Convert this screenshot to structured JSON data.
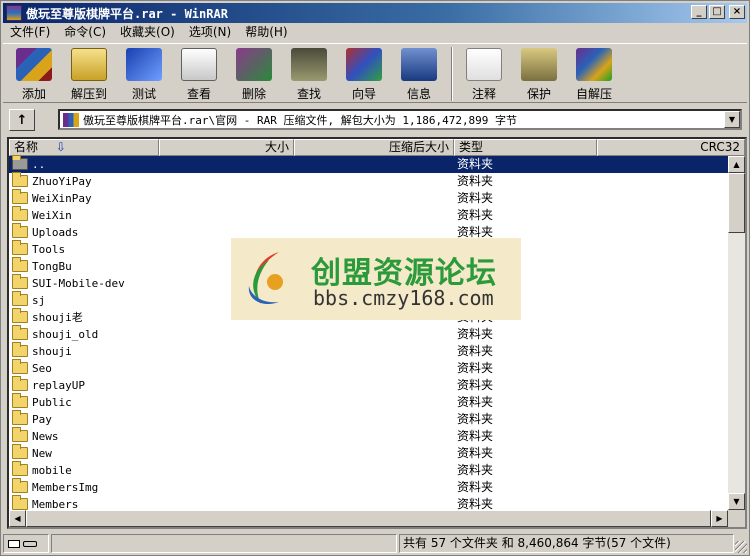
{
  "window": {
    "title": "傲玩至尊版棋牌平台.rar - WinRAR",
    "minimize": "_",
    "maximize": "□",
    "close": "×"
  },
  "menu": [
    {
      "label": "文件(F)"
    },
    {
      "label": "命令(C)"
    },
    {
      "label": "收藏夹(O)"
    },
    {
      "label": "选项(N)"
    },
    {
      "label": "帮助(H)"
    }
  ],
  "toolbar": [
    {
      "label": "添加",
      "icon": "add-icon"
    },
    {
      "label": "解压到",
      "icon": "extract-icon"
    },
    {
      "label": "测试",
      "icon": "test-icon"
    },
    {
      "label": "查看",
      "icon": "view-icon"
    },
    {
      "label": "删除",
      "icon": "delete-icon"
    },
    {
      "label": "查找",
      "icon": "find-icon"
    },
    {
      "label": "向导",
      "icon": "wizard-icon"
    },
    {
      "label": "信息",
      "icon": "info-icon"
    },
    {
      "label": "注释",
      "icon": "comment-icon"
    },
    {
      "label": "保护",
      "icon": "protect-icon"
    },
    {
      "label": "自解压",
      "icon": "sfx-icon"
    }
  ],
  "address": {
    "up_icon": "↑",
    "path": "傲玩至尊版棋牌平台.rar\\官网 - RAR 压缩文件, 解包大小为 1,186,472,899 字节",
    "dropdown": "▼"
  },
  "columns": {
    "name": "名称",
    "sort_arrow": "⇩",
    "size": "大小",
    "packed": "压缩后大小",
    "type": "类型",
    "crc": "CRC32"
  },
  "files": [
    {
      "name": "..",
      "type": "资料夹",
      "selected": true
    },
    {
      "name": "ZhuoYiPay",
      "type": "资料夹"
    },
    {
      "name": "WeiXinPay",
      "type": "资料夹"
    },
    {
      "name": "WeiXin",
      "type": "资料夹"
    },
    {
      "name": "Uploads",
      "type": "资料夹"
    },
    {
      "name": "Tools",
      "type": "资料夹"
    },
    {
      "name": "TongBu",
      "type": "资料夹"
    },
    {
      "name": "SUI-Mobile-dev",
      "type": "资料夹"
    },
    {
      "name": "sj",
      "type": "资料夹"
    },
    {
      "name": "shouji老",
      "type": "资料夹"
    },
    {
      "name": "shouji_old",
      "type": "资料夹"
    },
    {
      "name": "shouji",
      "type": "资料夹"
    },
    {
      "name": "Seo",
      "type": "资料夹"
    },
    {
      "name": "replayUP",
      "type": "资料夹"
    },
    {
      "name": "Public",
      "type": "资料夹"
    },
    {
      "name": "Pay",
      "type": "资料夹"
    },
    {
      "name": "News",
      "type": "资料夹"
    },
    {
      "name": "New",
      "type": "资料夹"
    },
    {
      "name": "mobile",
      "type": "资料夹"
    },
    {
      "name": "MembersImg",
      "type": "资料夹"
    },
    {
      "name": "Members",
      "type": "资料夹"
    }
  ],
  "watermark": {
    "title": "创盟资源论坛",
    "url": "bbs.cmzy168.com"
  },
  "status": {
    "summary": "共有 57 个文件夹 和 8,460,864 字节(57 个文件)"
  }
}
